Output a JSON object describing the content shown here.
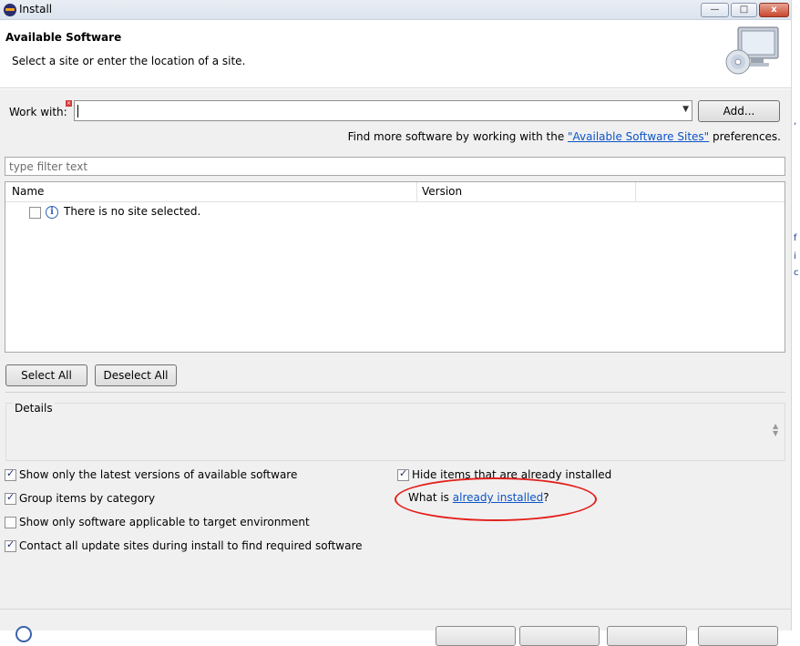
{
  "window": {
    "title": "Install",
    "min_label": "—",
    "max_label": "□",
    "close_label": "x"
  },
  "header": {
    "title": "Available Software",
    "subtitle": "Select a site or enter the location of a site."
  },
  "work_with": {
    "label": "Work with:",
    "value": "",
    "add_label": "Add...",
    "find_more_prefix": "Find more software by working with the ",
    "find_more_link": "\"Available Software Sites\"",
    "find_more_suffix": " preferences."
  },
  "filter": {
    "placeholder": "type filter text"
  },
  "tree": {
    "columns": [
      "Name",
      "Version"
    ],
    "rows": [
      {
        "text": "There is no site selected.",
        "checked": false
      }
    ]
  },
  "buttons": {
    "select_all": "Select All",
    "deselect_all": "Deselect All"
  },
  "details": {
    "label": "Details"
  },
  "options": [
    {
      "label": "Show only the latest versions of available software",
      "checked": true
    },
    {
      "label": "Group items by category",
      "checked": true
    },
    {
      "label": "Show only software applicable to target environment",
      "checked": false
    },
    {
      "label": "Contact all update sites during install to find required software",
      "checked": true
    },
    {
      "label": "Hide items that are already installed",
      "checked": true
    }
  ],
  "what_is": {
    "prefix": "What is ",
    "link": "already installed",
    "suffix": "?"
  },
  "annotation": {
    "color": "#e3201b"
  },
  "colors": {
    "link": "#0c55c6",
    "dialog_bg": "#f0f0f0"
  }
}
